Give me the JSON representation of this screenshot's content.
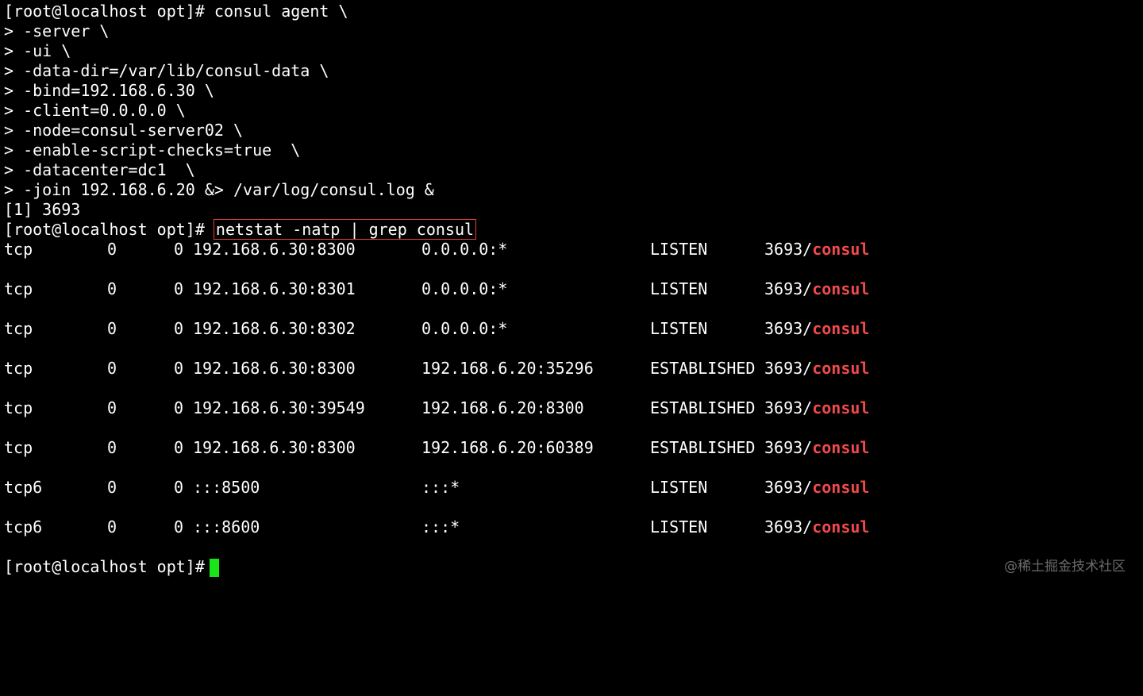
{
  "terminal": {
    "command_lines": [
      {
        "prompt": "[root@localhost opt]#",
        "text": " consul agent \\"
      },
      {
        "prompt": ">",
        "text": " -server \\"
      },
      {
        "prompt": ">",
        "text": " -ui \\"
      },
      {
        "prompt": ">",
        "text": " -data-dir=/var/lib/consul-data \\"
      },
      {
        "prompt": ">",
        "text": " -bind=192.168.6.30 \\"
      },
      {
        "prompt": ">",
        "text": " -client=0.0.0.0 \\"
      },
      {
        "prompt": ">",
        "text": " -node=consul-server02 \\"
      },
      {
        "prompt": ">",
        "text": " -enable-script-checks=true  \\"
      },
      {
        "prompt": ">",
        "text": " -datacenter=dc1  \\"
      },
      {
        "prompt": ">",
        "text": " -join 192.168.6.20 &> /var/log/consul.log &"
      }
    ],
    "job_line": "[1] 3693",
    "netstat_prompt": "[root@localhost opt]#",
    "netstat_command": "netstat -natp | grep consul",
    "netstat_rows": [
      {
        "proto": "tcp",
        "recv": "0",
        "send": "0",
        "local": "192.168.6.30:8300",
        "foreign": "0.0.0.0:*",
        "state": "LISTEN",
        "pid": "3693/",
        "prog": "consul"
      },
      {
        "proto": "tcp",
        "recv": "0",
        "send": "0",
        "local": "192.168.6.30:8301",
        "foreign": "0.0.0.0:*",
        "state": "LISTEN",
        "pid": "3693/",
        "prog": "consul"
      },
      {
        "proto": "tcp",
        "recv": "0",
        "send": "0",
        "local": "192.168.6.30:8302",
        "foreign": "0.0.0.0:*",
        "state": "LISTEN",
        "pid": "3693/",
        "prog": "consul"
      },
      {
        "proto": "tcp",
        "recv": "0",
        "send": "0",
        "local": "192.168.6.30:8300",
        "foreign": "192.168.6.20:35296",
        "state": "ESTABLISHED",
        "pid": "3693/",
        "prog": "consul"
      },
      {
        "proto": "tcp",
        "recv": "0",
        "send": "0",
        "local": "192.168.6.30:39549",
        "foreign": "192.168.6.20:8300",
        "state": "ESTABLISHED",
        "pid": "3693/",
        "prog": "consul"
      },
      {
        "proto": "tcp",
        "recv": "0",
        "send": "0",
        "local": "192.168.6.30:8300",
        "foreign": "192.168.6.20:60389",
        "state": "ESTABLISHED",
        "pid": "3693/",
        "prog": "consul"
      },
      {
        "proto": "tcp6",
        "recv": "0",
        "send": "0",
        "local": ":::8500",
        "foreign": ":::*",
        "state": "LISTEN",
        "pid": "3693/",
        "prog": "consul"
      },
      {
        "proto": "tcp6",
        "recv": "0",
        "send": "0",
        "local": ":::8600",
        "foreign": ":::*",
        "state": "LISTEN",
        "pid": "3693/",
        "prog": "consul"
      }
    ],
    "final_prompt": "[root@localhost opt]#",
    "watermark": "@稀土掘金技术社区"
  },
  "colors": {
    "background": "#000000",
    "text": "#ffffff",
    "highlight": "#f24a4a",
    "cursor": "#19e619",
    "box_outline": "#e0403a"
  }
}
